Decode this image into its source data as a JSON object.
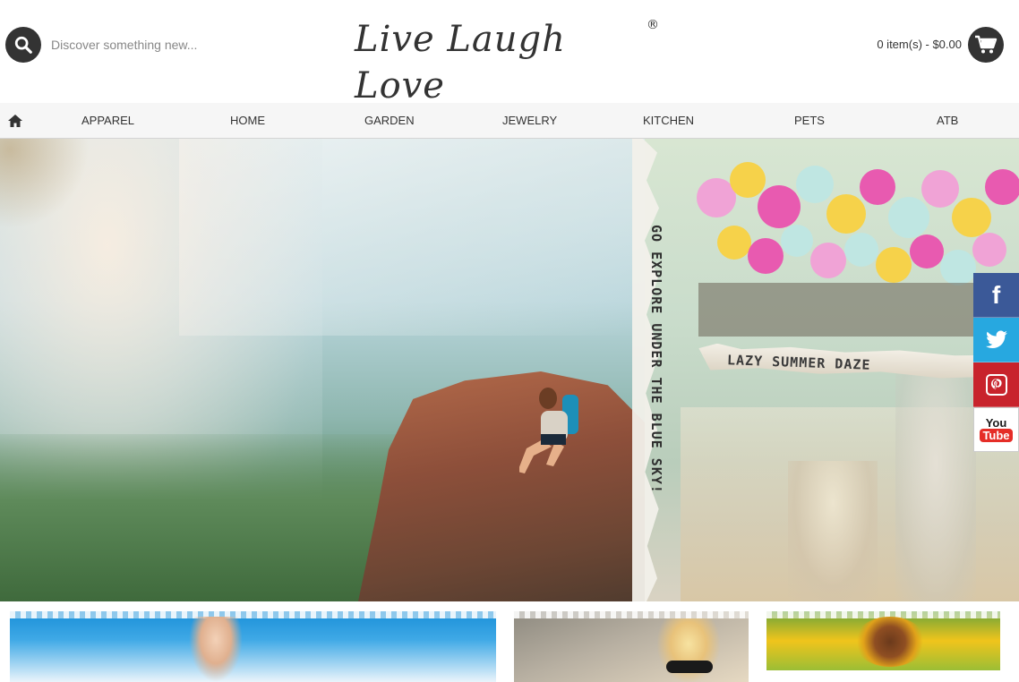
{
  "header": {
    "search_placeholder": "Discover something new...",
    "logo_text": "Live Laugh Love",
    "logo_mark": "®",
    "cart_summary": "0 item(s) - $0.00"
  },
  "nav": {
    "items": [
      {
        "label": "APPAREL"
      },
      {
        "label": "HOME"
      },
      {
        "label": "GARDEN"
      },
      {
        "label": "JEWELRY"
      },
      {
        "label": "KITCHEN"
      },
      {
        "label": "PETS"
      },
      {
        "label": "ATB"
      }
    ]
  },
  "hero": {
    "text_vertical": "GO EXPLORE UNDER THE BLUE SKY!",
    "text_strip": "LAZY SUMMER DAZE"
  },
  "social": {
    "facebook": "f",
    "youtube_line1": "You",
    "youtube_line2": "Tube"
  },
  "colors": {
    "icon_dark": "#333333",
    "facebook": "#3b5998",
    "twitter": "#27a8e0",
    "pinterest": "#c8232c",
    "youtube": "#e52d27"
  }
}
